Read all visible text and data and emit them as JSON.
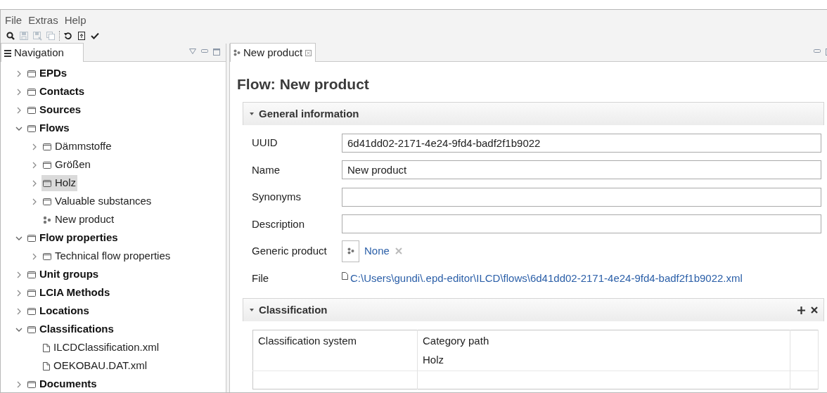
{
  "menu": [
    "File",
    "Extras",
    "Help"
  ],
  "toolbar": [
    {
      "kind": "search",
      "disabled": false
    },
    {
      "kind": "save",
      "disabled": true
    },
    {
      "kind": "save-as",
      "disabled": true
    },
    {
      "kind": "save-all",
      "disabled": true
    },
    {
      "kind": "separator"
    },
    {
      "kind": "reload",
      "disabled": false
    },
    {
      "kind": "document",
      "disabled": false
    },
    {
      "kind": "check",
      "disabled": false
    }
  ],
  "navigation": {
    "title": "Navigation",
    "items": [
      {
        "label": "EPDs",
        "kind": "folder",
        "expanded": false,
        "selected": false
      },
      {
        "label": "Contacts",
        "kind": "folder",
        "expanded": false,
        "selected": false
      },
      {
        "label": "Sources",
        "kind": "folder",
        "expanded": false,
        "selected": false
      },
      {
        "label": "Flows",
        "kind": "folder",
        "expanded": true,
        "selected": false,
        "children": [
          {
            "label": "Dämmstoffe",
            "kind": "folder",
            "expanded": false,
            "selected": false
          },
          {
            "label": "Größen",
            "kind": "folder",
            "expanded": false,
            "selected": false
          },
          {
            "label": "Holz",
            "kind": "folder",
            "expanded": false,
            "selected": true
          },
          {
            "label": "Valuable substances",
            "kind": "folder",
            "expanded": false,
            "selected": false
          },
          {
            "label": "New product",
            "kind": "product",
            "selected": false
          }
        ]
      },
      {
        "label": "Flow properties",
        "kind": "folder",
        "expanded": true,
        "selected": false,
        "children": [
          {
            "label": "Technical flow properties",
            "kind": "folder",
            "expanded": false,
            "selected": false
          }
        ]
      },
      {
        "label": "Unit groups",
        "kind": "folder",
        "expanded": false,
        "selected": false
      },
      {
        "label": "LCIA Methods",
        "kind": "folder",
        "expanded": false,
        "selected": false
      },
      {
        "label": "Locations",
        "kind": "folder",
        "expanded": false,
        "selected": false
      },
      {
        "label": "Classifications",
        "kind": "folder",
        "expanded": true,
        "selected": false,
        "children": [
          {
            "label": "ILCDClassification.xml",
            "kind": "file",
            "selected": false
          },
          {
            "label": "OEKOBAU.DAT.xml",
            "kind": "file",
            "selected": false
          }
        ]
      },
      {
        "label": "Documents",
        "kind": "folder",
        "expanded": false,
        "selected": false
      }
    ]
  },
  "editor_tabs": [
    {
      "label": "New product",
      "selected": true
    }
  ],
  "editor": {
    "title": "Flow: New product",
    "general_information": {
      "title": "General information",
      "expanded": true,
      "fields": [
        {
          "label": "UUID",
          "kind": "text",
          "value": "6d41dd02-2171-4e24-9fd4-badf2f1b9022"
        },
        {
          "label": "Name",
          "kind": "text",
          "value": "New product"
        },
        {
          "label": "Synonyms",
          "kind": "text"
        },
        {
          "label": "Description",
          "kind": "text"
        },
        {
          "label": "Generic product",
          "kind": "reference",
          "value": "None"
        },
        {
          "label": "File",
          "kind": "file",
          "value": "C:\\Users\\gundi\\.epd-editor\\ILCD\\flows\\6d41dd02-2171-4e24-9fd4-badf2f1b9022.xml"
        }
      ]
    },
    "classification": {
      "title": "Classification",
      "expanded": true,
      "columns": [
        "Classification system",
        "Category path"
      ],
      "rows": [
        [
          "",
          "Holz"
        ]
      ]
    }
  }
}
